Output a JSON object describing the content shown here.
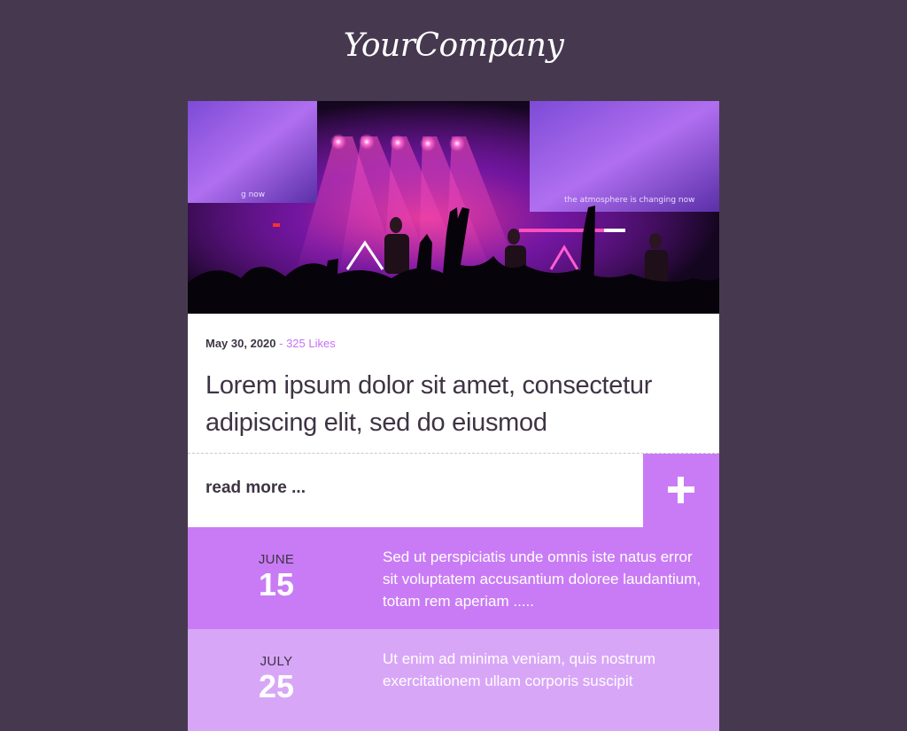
{
  "brand": {
    "logo_text": "YourCompany"
  },
  "post": {
    "date": "May 30, 2020",
    "separator": " - ",
    "likes": "325 Likes",
    "title": "Lorem ipsum dolor sit amet, consectetur adipiscing elit, sed do eiusmod",
    "read_more": "read more ...",
    "hero_screen_text_left": "g now",
    "hero_screen_text_right": "the atmosphere is changing now"
  },
  "events": [
    {
      "month": "JUNE",
      "day": "15",
      "text": "Sed ut perspiciatis unde omnis iste natus error sit voluptatem accusantium doloree laudantium, totam rem aperiam ....."
    },
    {
      "month": "JULY",
      "day": "25",
      "text": "Ut enim ad minima veniam, quis nostrum exercitationem ullam corporis suscipit"
    }
  ],
  "colors": {
    "background": "#46394f",
    "accent": "#c97bf5",
    "accent_light": "#d8a6f7",
    "text_dark": "#3e3444",
    "likes": "#c96ef5"
  },
  "icons": {
    "expand": "plus-icon"
  }
}
